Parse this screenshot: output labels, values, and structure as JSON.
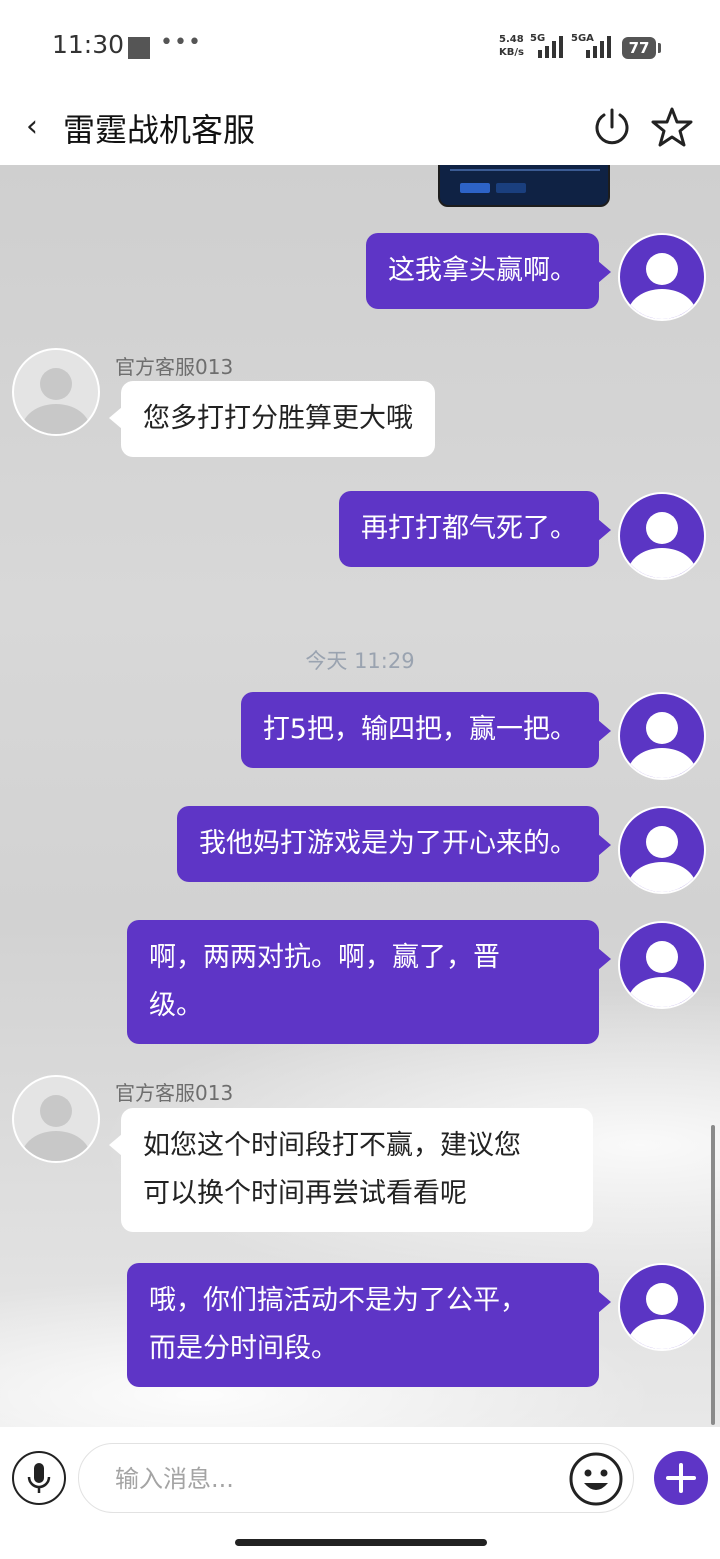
{
  "status": {
    "time": "11:30",
    "net_speed_value": "5.48",
    "net_speed_unit": "KB/s",
    "signal1": "5G",
    "signal2": "5GA",
    "battery": "77"
  },
  "header": {
    "back_icon": "‹",
    "title": "雷霆战机客服"
  },
  "messages": [
    {
      "from": "me",
      "text": "这我拿头赢啊。"
    },
    {
      "from": "cs",
      "sender": "官方客服013",
      "text": "您多打打分胜算更大哦"
    },
    {
      "from": "me",
      "text": "再打打都气死了。"
    },
    {
      "from": "me",
      "text": "打5把，输四把，赢一把。"
    },
    {
      "from": "me",
      "text": "我他妈打游戏是为了开心来的。"
    },
    {
      "from": "me",
      "line1": "啊，两两对抗。啊，赢了，晋",
      "line2": "级。"
    },
    {
      "from": "cs",
      "sender": "官方客服013",
      "line1": "如您这个时间段打不赢，建议您",
      "line2": "可以换个时间再尝试看看呢"
    },
    {
      "from": "me",
      "line1": "哦，你们搞活动不是为了公平，",
      "line2": "而是分时间段。"
    }
  ],
  "timestamp": "今天 11:29",
  "input": {
    "placeholder": "输入消息..."
  }
}
